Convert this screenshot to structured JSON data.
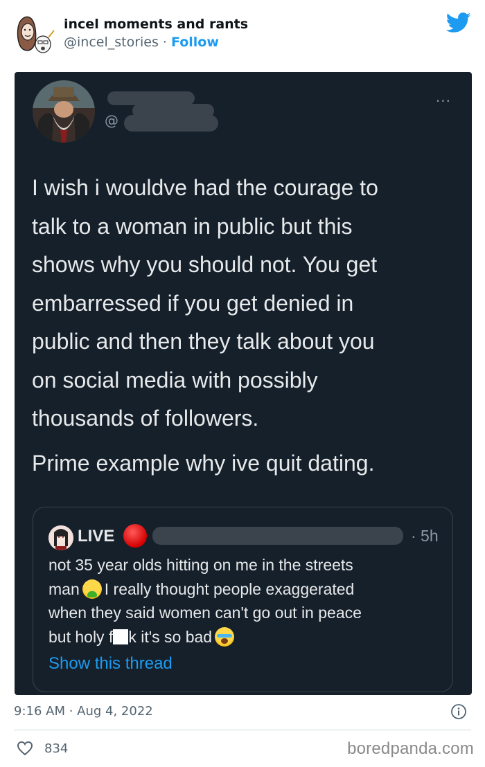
{
  "header": {
    "account_name": "incel moments and rants",
    "handle": "@incel_stories",
    "separator": " · ",
    "follow_label": "Follow"
  },
  "screenshot": {
    "at_symbol": "@",
    "more_label": "...",
    "tweet_lines": [
      "I wish i wouldve had the courage to",
      "talk to a woman in public but this",
      "shows why you should not. You get",
      "embarressed if you get denied in",
      "public and then they talk about you",
      "on social media with possibly",
      "thousands of followers."
    ],
    "tweet_line2": "Prime example why ive quit dating.",
    "quote": {
      "live_label": "LIVE",
      "time": "· 5h",
      "body_line1": "not 35 year olds hitting on me in the streets",
      "body_line2_a": "man",
      "body_line2_b": "I really thought people exaggerated",
      "body_line3": "when they said women can't go out in peace",
      "body_line4_a": "but holy f",
      "body_line4_b": "k it's so bad",
      "show_thread": "Show this thread"
    }
  },
  "footer": {
    "timestamp": "9:16 AM · Aug 4, 2022",
    "likes": "834",
    "watermark": "boredpanda.com"
  },
  "colors": {
    "twitter_blue": "#1d9bf0",
    "dark_bg": "#15202b",
    "live_red": "#d40000"
  },
  "icons": [
    "avatar-sketch",
    "twitter-bird-icon",
    "more-icon",
    "info-icon",
    "heart-icon",
    "nauseated-face-emoji",
    "crying-face-emoji"
  ]
}
